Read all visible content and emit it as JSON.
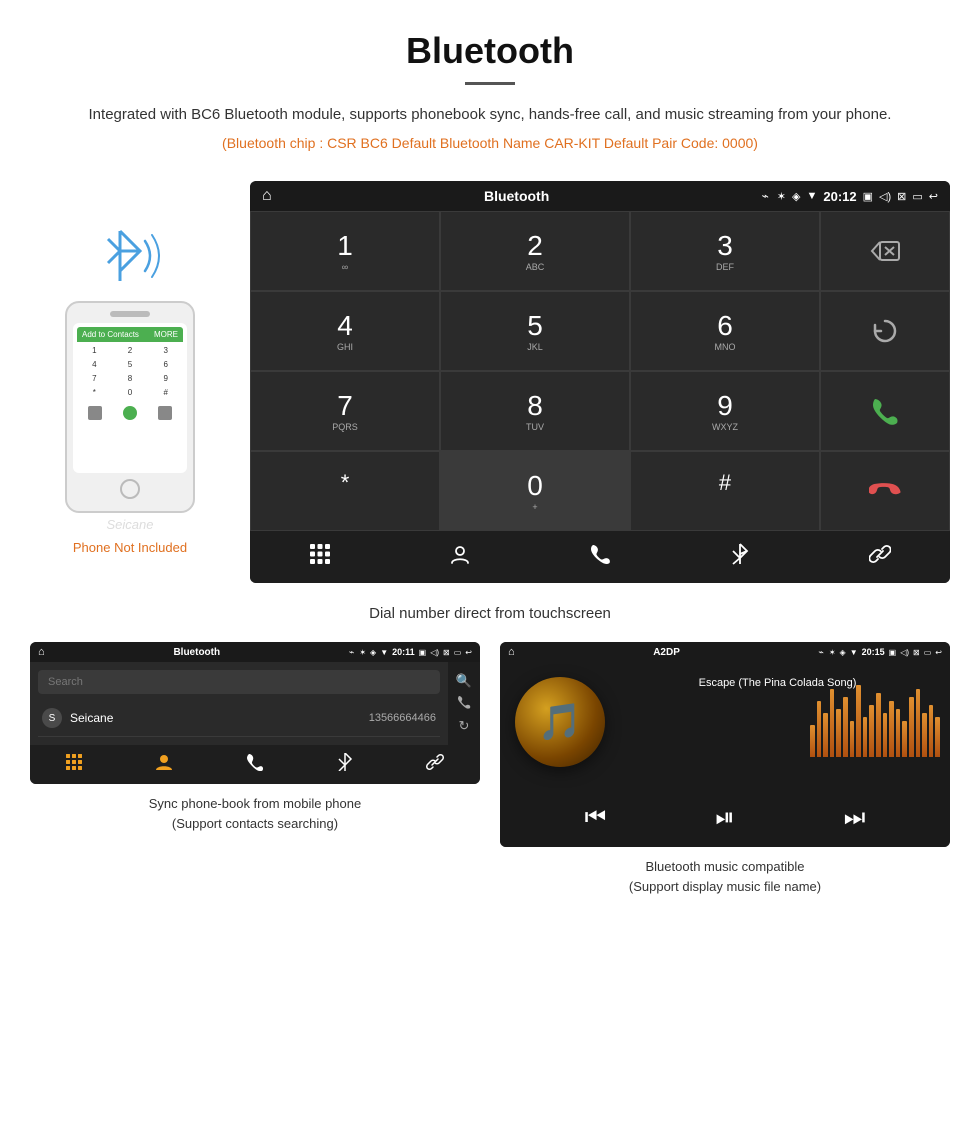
{
  "header": {
    "title": "Bluetooth",
    "description": "Integrated with BC6 Bluetooth module, supports phonebook sync, hands-free call, and music streaming from your phone.",
    "bluetooth_info": "(Bluetooth chip : CSR BC6    Default Bluetooth Name CAR-KIT    Default Pair Code: 0000)"
  },
  "main_screen": {
    "statusbar": {
      "home_icon": "⌂",
      "title": "Bluetooth",
      "usb_icon": "⌁",
      "bt_icon": "✶",
      "location_icon": "◈",
      "signal_icon": "▼",
      "time": "20:12",
      "camera_icon": "▣",
      "volume_icon": "◁)",
      "close_icon": "⊠",
      "window_icon": "▭",
      "back_icon": "↩"
    },
    "dialpad": {
      "keys": [
        {
          "number": "1",
          "letters": "∞"
        },
        {
          "number": "2",
          "letters": "ABC"
        },
        {
          "number": "3",
          "letters": "DEF"
        },
        {
          "number": "4",
          "letters": "GHI"
        },
        {
          "number": "5",
          "letters": "JKL"
        },
        {
          "number": "6",
          "letters": "MNO"
        },
        {
          "number": "7",
          "letters": "PQRS"
        },
        {
          "number": "8",
          "letters": "TUV"
        },
        {
          "number": "9",
          "letters": "WXYZ"
        },
        {
          "number": "*",
          "letters": ""
        },
        {
          "number": "0",
          "letters": "+"
        },
        {
          "number": "#",
          "letters": ""
        }
      ]
    },
    "bottom_icons": [
      "⊞",
      "♟",
      "☎",
      "✶",
      "✎"
    ],
    "caption": "Dial number direct from touchscreen"
  },
  "phone": {
    "not_included": "Phone Not Included",
    "bluetooth_signal": "bt-signal",
    "screen_header": "Add to Contacts",
    "phone_number": "MORE",
    "dialpad_keys": [
      "1",
      "2",
      "3",
      "4",
      "5",
      "6",
      "7",
      "8",
      "9",
      "*",
      "0",
      "#"
    ],
    "watermark": "Seicane"
  },
  "phonebook_screen": {
    "statusbar": {
      "home_icon": "⌂",
      "title": "Bluetooth",
      "usb_icon": "⌁"
    },
    "search_placeholder": "Search",
    "contacts": [
      {
        "letter": "S",
        "name": "Seicane",
        "number": "13566664466"
      }
    ],
    "right_icons": [
      "🔍",
      "☎",
      "↻"
    ],
    "bottom_icons": [
      "⊞",
      "♟",
      "☎",
      "✶",
      "✎"
    ],
    "caption_line1": "Sync phone-book from mobile phone",
    "caption_line2": "(Support contacts searching)"
  },
  "music_screen": {
    "statusbar": {
      "home_icon": "⌂",
      "title": "A2DP",
      "usb_icon": "⌁"
    },
    "song_title": "Escape (The Pina Colada Song)",
    "equalizer_bars": [
      40,
      70,
      55,
      85,
      60,
      75,
      45,
      90,
      50,
      65,
      80,
      55,
      70,
      60,
      45,
      75,
      85,
      55,
      65,
      50
    ],
    "controls": [
      "⏮",
      "⏯",
      "⏭"
    ],
    "time": "20:15",
    "caption_line1": "Bluetooth music compatible",
    "caption_line2": "(Support display music file name)"
  }
}
